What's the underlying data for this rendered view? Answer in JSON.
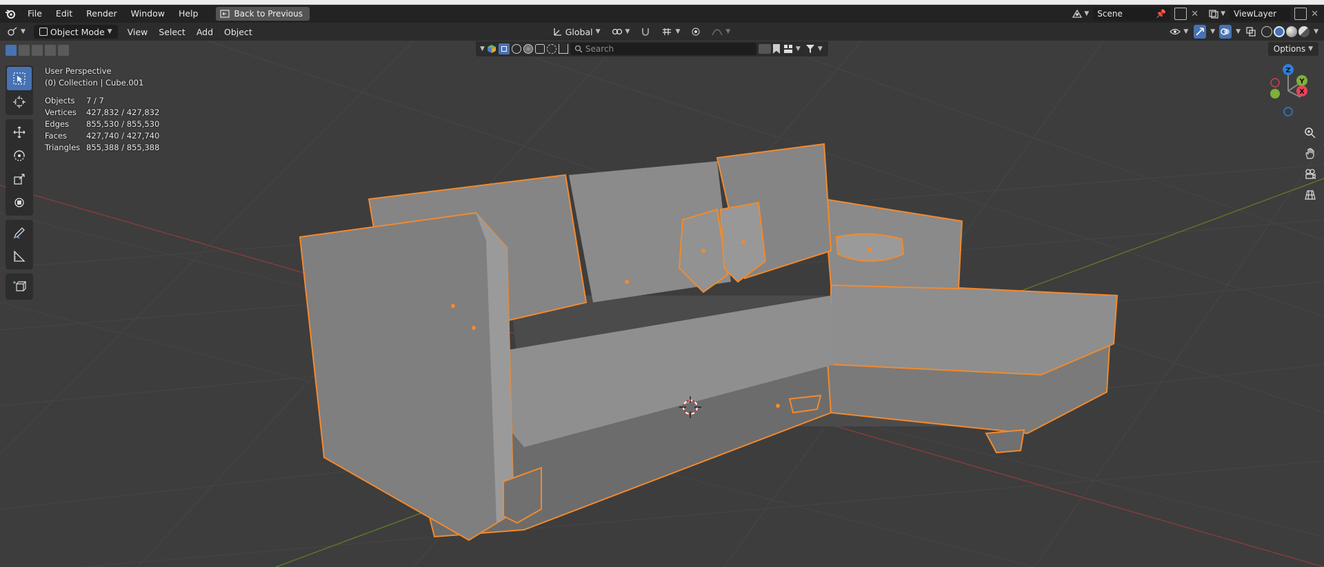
{
  "menu": {
    "file": "File",
    "edit": "Edit",
    "render": "Render",
    "window": "Window",
    "help": "Help",
    "back_to_previous": "Back to Previous"
  },
  "top_right": {
    "scene": "Scene",
    "view_layer": "ViewLayer"
  },
  "header": {
    "mode": "Object Mode",
    "view": "View",
    "select": "Select",
    "add": "Add",
    "object": "Object",
    "transform_orientation": "Global",
    "options": "Options"
  },
  "search": {
    "placeholder": "Search"
  },
  "viewport": {
    "perspective": "User Perspective",
    "collection": "(0) Collection | Cube.001"
  },
  "stats": [
    {
      "label": "Objects",
      "value": "7 / 7"
    },
    {
      "label": "Vertices",
      "value": "427,832 / 427,832"
    },
    {
      "label": "Edges",
      "value": "855,530 / 855,530"
    },
    {
      "label": "Faces",
      "value": "427,740 / 427,740"
    },
    {
      "label": "Triangles",
      "value": "855,388 / 855,388"
    }
  ],
  "gizmo": {
    "z": "Z",
    "y": "Y",
    "x": "X"
  },
  "colors": {
    "accent": "#4772b3",
    "selection_outline": "#f28a2e",
    "background": "#3d3d3d"
  }
}
